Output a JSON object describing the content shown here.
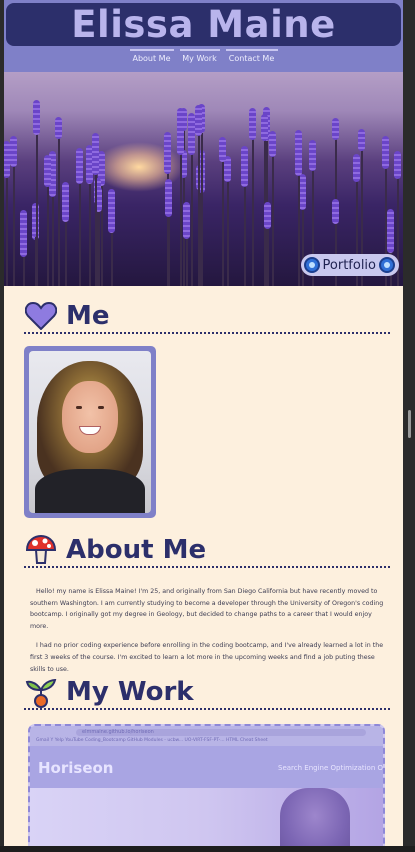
{
  "header": {
    "title": "Elissa Maine",
    "nav": [
      {
        "label": "About Me"
      },
      {
        "label": "My Work"
      },
      {
        "label": "Contact Me"
      }
    ]
  },
  "hero": {
    "badge_label": "Portfolio",
    "badge_icon": "blue-gem-icon"
  },
  "sections": {
    "me": {
      "title": "Me",
      "icon": "heart-icon"
    },
    "about": {
      "title": "About Me",
      "icon": "mushroom-icon",
      "paragraphs": [
        "Hello! my name is Elissa Maine! I'm 25, and originally from San Diego California but have recently moved to southern Washington. I am currently studying to become a developer through the University of Oregon's coding bootcamp. I originally got my degree in Geology, but decided to change paths to a career that I would enjoy more.",
        "I had no prior coding experience before enrolling in the coding bootcamp, and I've already learned a lot in the first 3 weeks of the course. I'm excited to learn a lot more in the upcoming weeks and find a job puting these skills to use."
      ]
    },
    "work": {
      "title": "My Work",
      "icon": "sprout-icon",
      "preview": {
        "site_name": "Horiseon",
        "nav_text": "Search Engine Optimization    Onli",
        "url": "elmmaine.github.io/horiseon",
        "tabs": "Gmail   Y Yelp   YouTube   Coding_Bootcamp   GitHub   Modules - ucbw...   UO-VIRT-FSF-PT-...   HTML Cheat Sheet"
      }
    }
  },
  "colors": {
    "title_bar": "#2c2f6b",
    "header_bg": "#7f80c8",
    "title_text": "#b9b4ec",
    "page_bg": "#fdf0de",
    "heading": "#2c2f6b"
  }
}
